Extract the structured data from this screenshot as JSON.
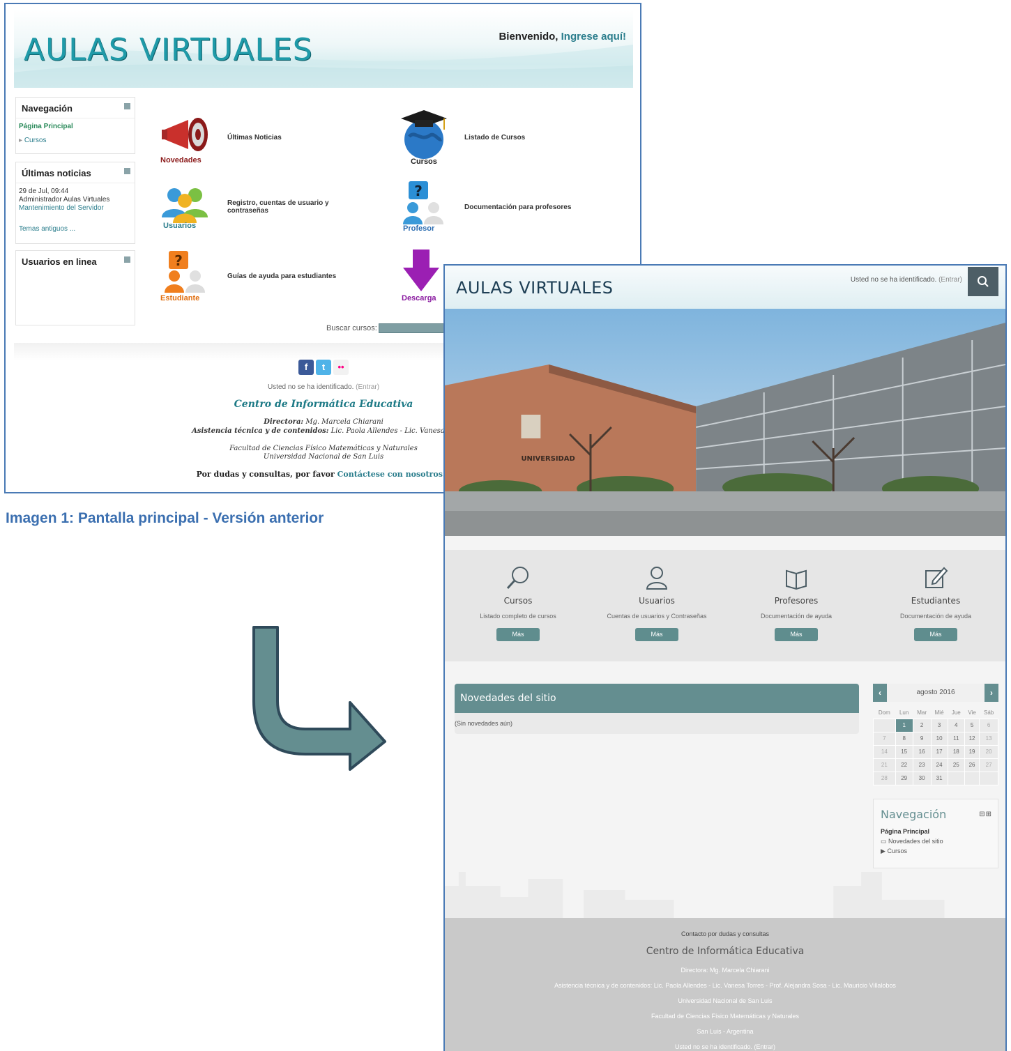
{
  "old": {
    "logo": "AULAS VIRTUALES",
    "welcome_text": "Bienvenido,",
    "welcome_link": "Ingrese aquí!",
    "nav_block": {
      "title": "Navegación",
      "home": "Página Principal",
      "courses": "Cursos"
    },
    "news_block": {
      "title": "Últimas noticias",
      "date": "29 de Jul, 09:44",
      "author": "Administrador Aulas Virtuales",
      "link": "Mantenimiento del Servidor",
      "older": "Temas antiguos ..."
    },
    "users_block": {
      "title": "Usuarios en linea"
    },
    "items": [
      {
        "icon": "megaphone-icon",
        "caption": "Novedades",
        "label": "Últimas Noticias"
      },
      {
        "icon": "globe-graduation-icon",
        "caption": "Cursos",
        "label": "Listado de Cursos"
      },
      {
        "icon": "users-icon",
        "caption": "Usuarios",
        "label": "Registro, cuentas de usuario y contraseñas"
      },
      {
        "icon": "teacher-question-icon",
        "caption": "Profesor",
        "label": "Documentación para profesores"
      },
      {
        "icon": "student-question-icon",
        "caption": "Estudiante",
        "label": "Guías de ayuda para estudiantes"
      },
      {
        "icon": "download-arrow-icon",
        "caption": "Descarga",
        "label": ""
      }
    ],
    "search_label": "Buscar cursos:",
    "footer": {
      "login_status": "Usted no se ha identificado.",
      "login_link": "(Entrar)",
      "center": "Centro de Informática Educativa",
      "director_label": "Directora:",
      "director": "Mg. Marcela Chiarani",
      "assist_label": "Asistencia técnica y de contenidos:",
      "assist": "Lic. Paola Allendes - Lic. Vanesa To",
      "faculty": "Facultad de Ciencias Físico Matemáticas y Naturales",
      "university": "Universidad Nacional de San Luis",
      "contact_text": "Por dudas y consultas, por favor",
      "contact_link": "Contáctese con nosotros..."
    }
  },
  "caption": "Imagen 1: Pantalla principal - Versión anterior",
  "new": {
    "logo": "AULAS VIRTUALES",
    "login_status": "Usted no se ha identificado.",
    "login_link": "(Entrar)",
    "features": [
      {
        "icon": "search-icon",
        "title": "Cursos",
        "desc": "Listado completo de cursos",
        "button": "Más"
      },
      {
        "icon": "user-icon",
        "title": "Usuarios",
        "desc": "Cuentas de usuarios y Contraseñas",
        "button": "Más"
      },
      {
        "icon": "book-icon",
        "title": "Profesores",
        "desc": "Documentación de ayuda",
        "button": "Más"
      },
      {
        "icon": "edit-icon",
        "title": "Estudiantes",
        "desc": "Documentación de ayuda",
        "button": "Más"
      }
    ],
    "news": {
      "title": "Novedades del sitio",
      "empty": "(Sin novedades aún)"
    },
    "calendar": {
      "month": "agosto 2016",
      "days": [
        "Dom",
        "Lun",
        "Mar",
        "Mié",
        "Jue",
        "Vie",
        "Sáb"
      ],
      "weeks": [
        [
          "",
          "1",
          "2",
          "3",
          "4",
          "5",
          "6"
        ],
        [
          "7",
          "8",
          "9",
          "10",
          "11",
          "12",
          "13"
        ],
        [
          "14",
          "15",
          "16",
          "17",
          "18",
          "19",
          "20"
        ],
        [
          "21",
          "22",
          "23",
          "24",
          "25",
          "26",
          "27"
        ],
        [
          "28",
          "29",
          "30",
          "31",
          "",
          "",
          ""
        ]
      ],
      "today": "1"
    },
    "nav": {
      "title": "Navegación",
      "home": "Página Principal",
      "news": "Novedades del sitio",
      "courses": "Cursos"
    },
    "footer": {
      "contact": "Contacto por dudas y consultas",
      "center": "Centro de Informática Educativa",
      "director": "Directora: Mg. Marcela Chiarani",
      "assist": "Asistencia técnica y de contenidos: Lic. Paola Allendes - Lic. Vanesa Torres - Prof. Alejandra Sosa - Lic. Mauricio Villalobos",
      "university": "Universidad Nacional de San Luis",
      "faculty": "Facultad de Ciencias Físico Matemáticas y Naturales",
      "location": "San Luis - Argentina",
      "login": "Usted no se ha identificado. (Entrar)"
    }
  },
  "colors": {
    "old_teal": "#1f9aa8",
    "new_teal": "#648e90",
    "caption_blue": "#3b6fb0",
    "arrow_fill": "#648e90"
  }
}
